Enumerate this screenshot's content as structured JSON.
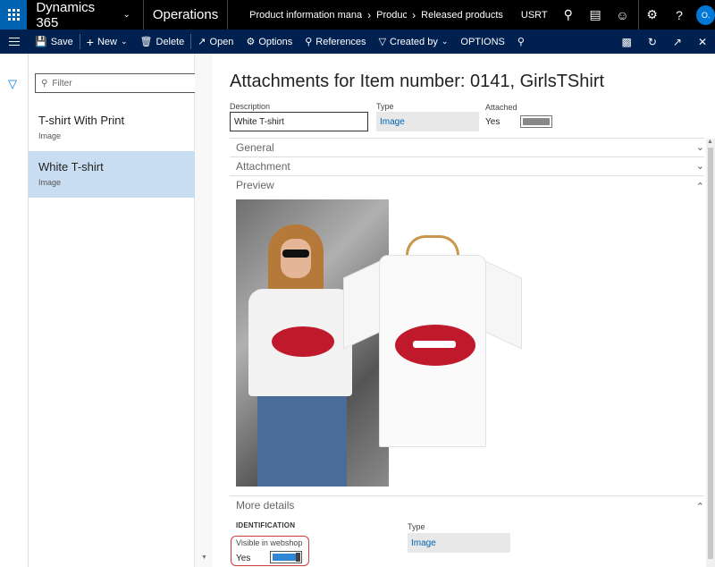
{
  "topbar": {
    "product": "Dynamics 365",
    "app": "Operations",
    "breadcrumbs": [
      "Product information manag",
      "Produc",
      "Released products"
    ],
    "company": "USRT",
    "avatar_initials": "O."
  },
  "actions": {
    "save": "Save",
    "new": "New",
    "delete": "Delete",
    "open": "Open",
    "options": "Options",
    "references": "References",
    "created_by": "Created by",
    "options_tab": "OPTIONS"
  },
  "list": {
    "filter_placeholder": "Filter",
    "items": [
      {
        "title": "T-shirt With Print",
        "type": "Image"
      },
      {
        "title": "White T-shirt",
        "type": "Image"
      }
    ]
  },
  "form": {
    "title": "Attachments for Item number: 0141, GirlsTShirt",
    "description_label": "Description",
    "description_value": "White T-shirt",
    "type_label": "Type",
    "type_value": "Image",
    "attached_label": "Attached",
    "attached_value": "Yes"
  },
  "sections": {
    "general": "General",
    "attachment": "Attachment",
    "preview": "Preview",
    "more_details": "More details"
  },
  "more_details": {
    "identification_heading": "IDENTIFICATION",
    "visible_label": "Visible in webshop",
    "visible_value": "Yes",
    "type_label": "Type",
    "type_value": "Image"
  },
  "colors": {
    "topbar_bg": "#000000",
    "actionbar_bg": "#002050",
    "accent": "#0078d7",
    "selected_row": "#c8ddf2",
    "highlight_outline": "#d23c3c"
  }
}
